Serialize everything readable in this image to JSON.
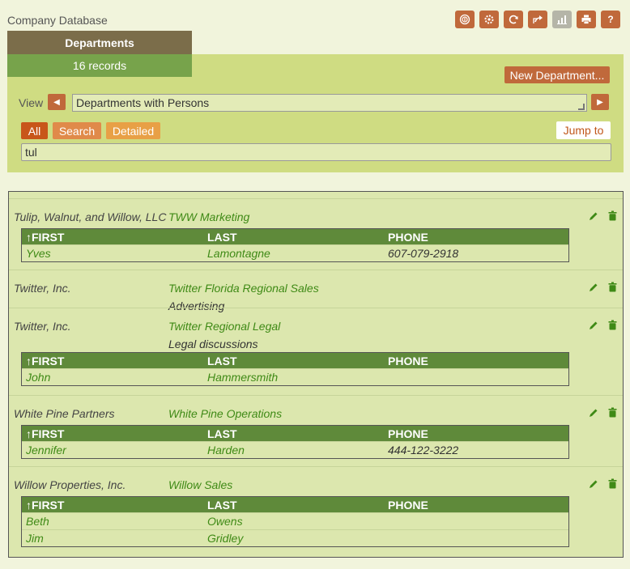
{
  "app": {
    "title": "Company Database"
  },
  "toolbar": {
    "buttons": [
      {
        "name": "chart-icon-tile",
        "icon": "fingerprint"
      },
      {
        "name": "settings",
        "icon": "gear"
      },
      {
        "name": "refresh",
        "icon": "refresh"
      },
      {
        "name": "export",
        "icon": "share"
      },
      {
        "name": "chart",
        "icon": "bar-chart"
      },
      {
        "name": "print",
        "icon": "printer"
      },
      {
        "name": "help",
        "icon": "question",
        "label": "?"
      }
    ]
  },
  "tab": {
    "title": "Departments",
    "count": "16 records"
  },
  "actions": {
    "new_label": "New Department..."
  },
  "view": {
    "label": "View",
    "selected": "Departments with Persons"
  },
  "filters": {
    "all": "All",
    "search": "Search",
    "detailed": "Detailed",
    "jump": "Jump to"
  },
  "search": {
    "value": "tul"
  },
  "table_headers": {
    "first": "↑FIRST",
    "last": "LAST",
    "phone": "PHONE"
  },
  "records": [
    {
      "company": "Tulip, Walnut, and Willow, LLC",
      "department": "TWW Marketing",
      "description": "",
      "persons": [
        {
          "first": "Yves",
          "last": "Lamontagne",
          "phone": "607-079-2918"
        }
      ]
    },
    {
      "company": "Twitter, Inc.",
      "department": "Twitter Florida Regional Sales",
      "description": "Advertising",
      "persons": []
    },
    {
      "company": "Twitter, Inc.",
      "department": "Twitter Regional Legal",
      "description": "Legal discussions",
      "persons": [
        {
          "first": "John",
          "last": "Hammersmith",
          "phone": ""
        }
      ]
    },
    {
      "company": "White Pine Partners",
      "department": "White Pine Operations",
      "description": "",
      "persons": [
        {
          "first": "Jennifer",
          "last": "Harden",
          "phone": "444-122-3222"
        }
      ]
    },
    {
      "company": "Willow Properties, Inc.",
      "department": "Willow Sales",
      "description": "",
      "persons": [
        {
          "first": "Beth",
          "last": "Owens",
          "phone": ""
        },
        {
          "first": "Jim",
          "last": "Gridley",
          "phone": ""
        }
      ]
    }
  ],
  "colors": {
    "accent": "#c0693b",
    "header_green": "#5f8a3a",
    "link_green": "#3f8a16",
    "panel": "#cfdc82"
  }
}
